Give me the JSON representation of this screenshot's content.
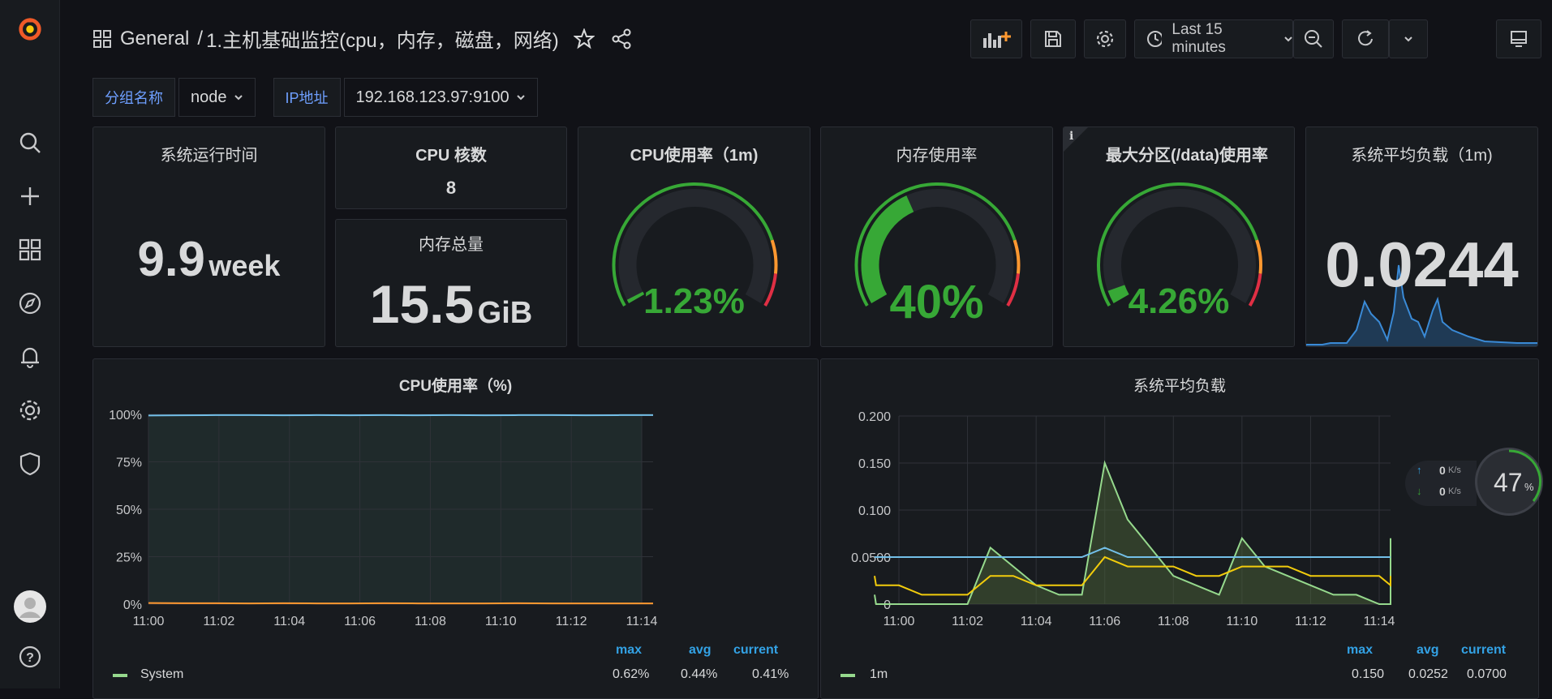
{
  "header": {
    "breadcrumb_folder": "General",
    "breadcrumb_sep": "/",
    "dashboard_title": "1.主机基础监控(cpu，内存，磁盘，网络)",
    "time_range": "Last 15 minutes"
  },
  "variables": [
    {
      "label": "分组名称",
      "value": "node"
    },
    {
      "label": "IP地址",
      "value": "192.168.123.97:9100"
    }
  ],
  "stats": {
    "uptime": {
      "title": "系统运行时间",
      "value": "9.9",
      "unit": "week"
    },
    "cpu_cores": {
      "title": "CPU 核数",
      "value": "8"
    },
    "mem_total": {
      "title": "内存总量",
      "value": "15.5",
      "unit": "GiB"
    },
    "cpu_gauge": {
      "title": "CPU使用率（1m)",
      "value": "1.23%",
      "fraction": 0.0123
    },
    "mem_gauge": {
      "title": "内存使用率",
      "value": "40%",
      "fraction": 0.4
    },
    "disk_gauge": {
      "title": "最大分区(/data)使用率",
      "value": "4.26%",
      "fraction": 0.0426,
      "info_icon": "i"
    },
    "load_stat": {
      "title": "系统平均负载（1m)",
      "value": "0.0244"
    }
  },
  "colors": {
    "green": "#37a836",
    "orange": "#ff9830",
    "red": "#e02f44",
    "blue": "#73bfe8",
    "yellow": "#f2cc0c",
    "lightgreen": "#96d98d",
    "legend_head": "#33a2e5"
  },
  "network_widget": {
    "up": "0",
    "up_unit": "K/s",
    "down": "0",
    "down_unit": "K/s",
    "percent": "47",
    "percent_sign": "%"
  },
  "chart_data": [
    {
      "type": "area",
      "title": "CPU使用率（%)",
      "y_ticks": [
        "100%",
        "75%",
        "50%",
        "25%",
        "0%"
      ],
      "ylim": [
        0,
        100
      ],
      "x_ticks": [
        "11:00",
        "11:02",
        "11:04",
        "11:06",
        "11:08",
        "11:10",
        "11:12",
        "11:14"
      ],
      "series": [
        {
          "name": "System",
          "color": "#73bfe8",
          "values": [
            99.4,
            99.5,
            99.6,
            99.6,
            99.5,
            99.6,
            99.5,
            99.6,
            99.5,
            99.6,
            99.5,
            99.6,
            99.6,
            99.5,
            99.6,
            99.6
          ]
        },
        {
          "name": "",
          "color": "#ff9830",
          "values": [
            0.6,
            0.5,
            0.5,
            0.4,
            0.5,
            0.4,
            0.4,
            0.5,
            0.4,
            0.4,
            0.4,
            0.5,
            0.4,
            0.4,
            0.4,
            0.4
          ]
        }
      ],
      "legend_headers": [
        "max",
        "avg",
        "current"
      ],
      "legend_rows": [
        {
          "name": "System",
          "max": "0.62%",
          "avg": "0.44%",
          "current": "0.41%"
        }
      ]
    },
    {
      "type": "line",
      "title": "系统平均负载",
      "y_ticks": [
        "0.200",
        "0.150",
        "0.100",
        "0.0500",
        "0"
      ],
      "ylim": [
        0,
        0.2
      ],
      "x_ticks": [
        "11:00",
        "11:02",
        "11:04",
        "11:06",
        "11:08",
        "11:10",
        "11:12",
        "11:14"
      ],
      "x_values": [
        10.5,
        10.833,
        11.167,
        11.5,
        11.833,
        12.167,
        12.5,
        12.833,
        13.167,
        13.5,
        13.833,
        14.167,
        14.5,
        14.833,
        15.167,
        15.5,
        15.833,
        16.167,
        16.5,
        16.833,
        17.167,
        17.5,
        17.833,
        18.167,
        18.5,
        18.833,
        19.167,
        19.5,
        19.833
      ],
      "series": [
        {
          "name": "1m",
          "color": "#96d98d",
          "fill": true,
          "values": [
            0.01,
            0.01,
            0,
            0,
            0,
            0,
            0,
            0.06,
            0.04,
            0.02,
            0.01,
            0.01,
            0.15,
            0.09,
            0.06,
            0.03,
            0.02,
            0.01,
            0.07,
            0.04,
            0.03,
            0.02,
            0.01,
            0.01,
            0,
            0,
            0,
            0,
            0.07
          ]
        },
        {
          "name": "",
          "color": "#f2cc0c",
          "values": [
            0.03,
            0.03,
            0.02,
            0.02,
            0.01,
            0.01,
            0.01,
            0.03,
            0.03,
            0.02,
            0.02,
            0.02,
            0.05,
            0.04,
            0.04,
            0.04,
            0.03,
            0.03,
            0.04,
            0.04,
            0.04,
            0.03,
            0.03,
            0.03,
            0.03,
            0.02,
            0.02,
            0.02,
            0.03
          ]
        },
        {
          "name": "",
          "color": "#73bfe8",
          "values": [
            0.05,
            0.05,
            0.05,
            0.05,
            0.05,
            0.05,
            0.05,
            0.05,
            0.05,
            0.05,
            0.05,
            0.05,
            0.06,
            0.05,
            0.05,
            0.05,
            0.05,
            0.05,
            0.05,
            0.05,
            0.05,
            0.05,
            0.05,
            0.05,
            0.05,
            0.05,
            0.05,
            0.05,
            0.05
          ]
        }
      ],
      "legend_headers": [
        "max",
        "avg",
        "current"
      ],
      "legend_rows": [
        {
          "name": "1m",
          "max": "0.150",
          "avg": "0.0252",
          "current": "0.0700"
        }
      ]
    }
  ]
}
